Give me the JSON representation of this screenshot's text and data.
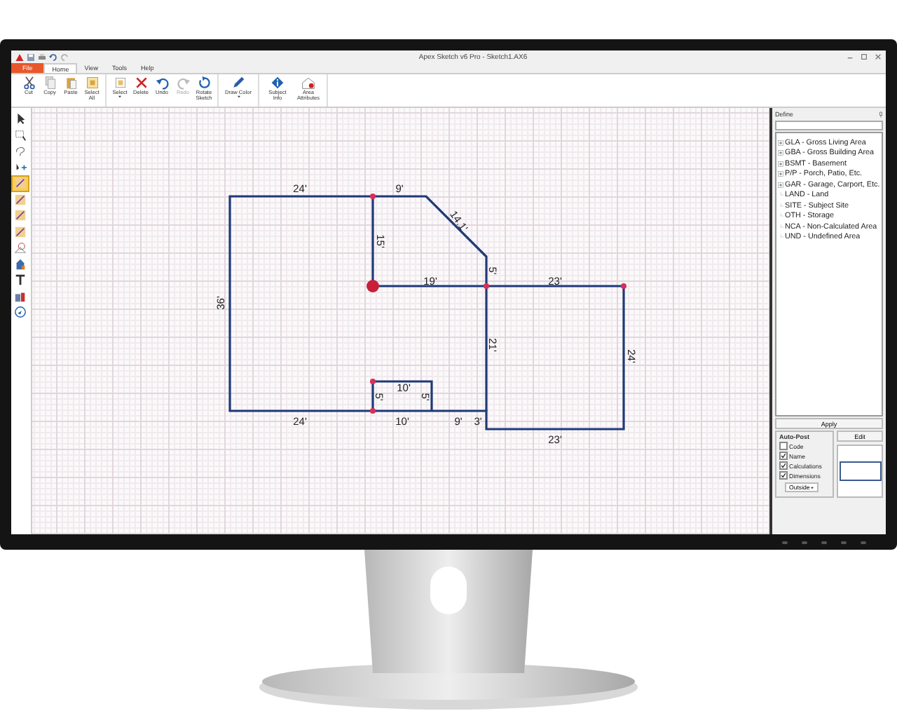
{
  "window": {
    "title": "Apex Sketch v6 Pro - Sketch1.AX6"
  },
  "tabs": [
    {
      "label": "File",
      "kind": "file",
      "selected": false
    },
    {
      "label": "Home",
      "kind": "tab",
      "selected": true
    },
    {
      "label": "View",
      "kind": "tab",
      "selected": false
    },
    {
      "label": "Tools",
      "kind": "tab",
      "selected": false
    },
    {
      "label": "Help",
      "kind": "tab",
      "selected": false
    }
  ],
  "ribbon": {
    "groups": [
      [
        {
          "label": "Cut",
          "disabled": false,
          "dropdown": false
        },
        {
          "label": "Copy",
          "disabled": false,
          "dropdown": false
        },
        {
          "label": "Paste",
          "disabled": false,
          "dropdown": false
        },
        {
          "label": "Select All",
          "disabled": false,
          "dropdown": false
        }
      ],
      [
        {
          "label": "Select",
          "disabled": false,
          "dropdown": true
        },
        {
          "label": "Delete",
          "disabled": false,
          "dropdown": false
        },
        {
          "label": "Undo",
          "disabled": false,
          "dropdown": false
        },
        {
          "label": "Redo",
          "disabled": true,
          "dropdown": false
        },
        {
          "label": "Rotate Sketch",
          "disabled": false,
          "dropdown": false
        }
      ],
      [
        {
          "label": "Draw Color",
          "disabled": false,
          "dropdown": true
        }
      ],
      [
        {
          "label": "Subject Info",
          "disabled": false,
          "dropdown": false
        },
        {
          "label": "Area Attributes",
          "disabled": false,
          "dropdown": false
        }
      ]
    ]
  },
  "left_toolbar": {
    "tools": [
      {
        "selected": false
      },
      {
        "selected": false
      },
      {
        "selected": false
      },
      {
        "selected": false
      },
      {
        "selected": true
      },
      {
        "selected": false
      },
      {
        "selected": false
      },
      {
        "selected": false
      },
      {
        "selected": false
      },
      {
        "selected": false
      },
      {
        "selected": false
      },
      {
        "selected": false
      },
      {
        "selected": false
      }
    ]
  },
  "sketch": {
    "dimension_labels": [
      "24'",
      "9'",
      "14.1'",
      "15'",
      "5'",
      "19'",
      "23'",
      "36'",
      "21'",
      "24'",
      "10'",
      "5'",
      "5'",
      "24'",
      "10'",
      "9'",
      "3'",
      "23'"
    ]
  },
  "define_panel": {
    "title": "Define",
    "items": [
      {
        "label": "GLA - Gross Living Area",
        "expandable": true
      },
      {
        "label": "GBA - Gross Building Area",
        "expandable": true
      },
      {
        "label": "BSMT - Basement",
        "expandable": true
      },
      {
        "label": "P/P - Porch, Patio, Etc.",
        "expandable": true
      },
      {
        "label": "GAR - Garage, Carport, Etc.",
        "expandable": true
      },
      {
        "label": "LAND - Land",
        "expandable": false
      },
      {
        "label": "SITE - Subject Site",
        "expandable": false
      },
      {
        "label": "OTH - Storage",
        "expandable": false
      },
      {
        "label": "NCA - Non-Calculated Area",
        "expandable": false
      },
      {
        "label": "UND - Undefined Area",
        "expandable": false
      }
    ],
    "apply_button": "Apply",
    "auto_post": {
      "title": "Auto-Post",
      "options": [
        {
          "label": "Code",
          "checked": false
        },
        {
          "label": "Name",
          "checked": true
        },
        {
          "label": "Calculations",
          "checked": true
        },
        {
          "label": "Dimensions",
          "checked": true
        }
      ],
      "placement": "Outside"
    },
    "edit_button": "Edit"
  }
}
